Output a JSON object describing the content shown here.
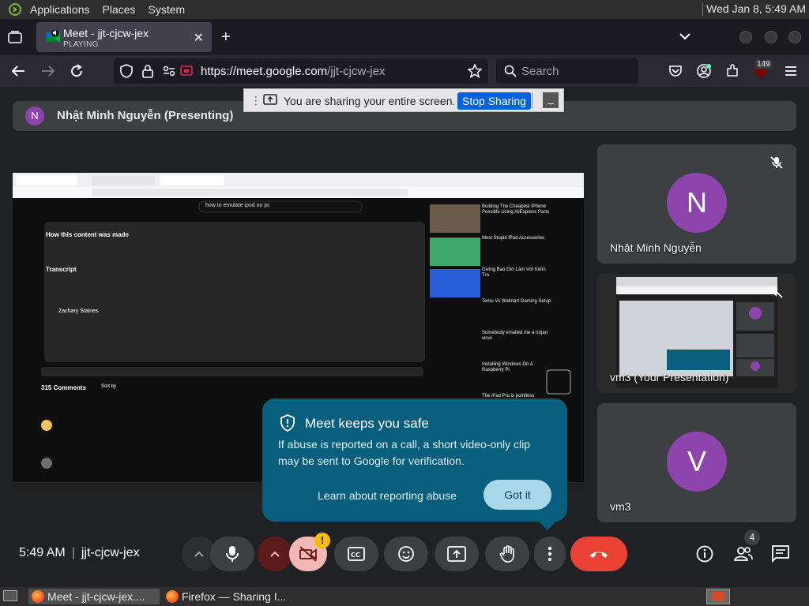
{
  "panel": {
    "menus": [
      "Applications",
      "Places",
      "System"
    ],
    "clock": "Wed Jan  8,  5:49 AM"
  },
  "browser": {
    "tab": {
      "title": "Meet - jjt-cjcw-jex",
      "status": "PLAYING"
    },
    "url_host": "https://meet.google.com",
    "url_path": "/jjt-cjcw-jex",
    "search_placeholder": "Search",
    "ext_badge": "149"
  },
  "sharing_bar": {
    "message": "You are sharing your entire screen.",
    "stop_label": "Stop Sharing"
  },
  "meet": {
    "presenter_initial": "N",
    "presenter_label": "Nhật Minh Nguyễn (Presenting)",
    "participants": [
      {
        "initial": "N",
        "name": "Nhật Minh Nguyễn",
        "color": "#8e44ad"
      },
      {
        "name": "vm3 (Your Presentation)"
      },
      {
        "initial": "V",
        "name": "vm3",
        "color": "#8e44ad"
      }
    ],
    "popup": {
      "title": "Meet keeps you safe",
      "body": "If abuse is reported on a call, a short video-only clip may be sent to Google for verification.",
      "learn": "Learn about reporting abuse",
      "got_it": "Got it"
    },
    "time": "5:49 AM",
    "meeting_code": "jjt-cjcw-jex",
    "people_count": "4",
    "warning": "!"
  },
  "shared_screen": {
    "search_query": "how to emulate ipod on pc",
    "section_heading": "How this content was made",
    "transcript_heading": "Transcript",
    "channel": "Zachary Staines",
    "comments_count": "315 Comments",
    "sort_by": "Sort by",
    "sidebar_videos": [
      "Building The Cheapest iPhone Possible Using AliExpress Parts",
      "Most Stupid iPad Accessories",
      "Giving Bao Giờ Làm Với Kiếm Tra",
      "Temu Vs Walmart Gaming Setup",
      "Somebody emailed me a trojan virus",
      "Installing Windows On A Raspberry Pi",
      "The iPad Pro is pointless"
    ]
  },
  "taskbar": {
    "items": [
      "Meet - jjt-cjcw-jex....",
      "Firefox — Sharing I..."
    ]
  }
}
